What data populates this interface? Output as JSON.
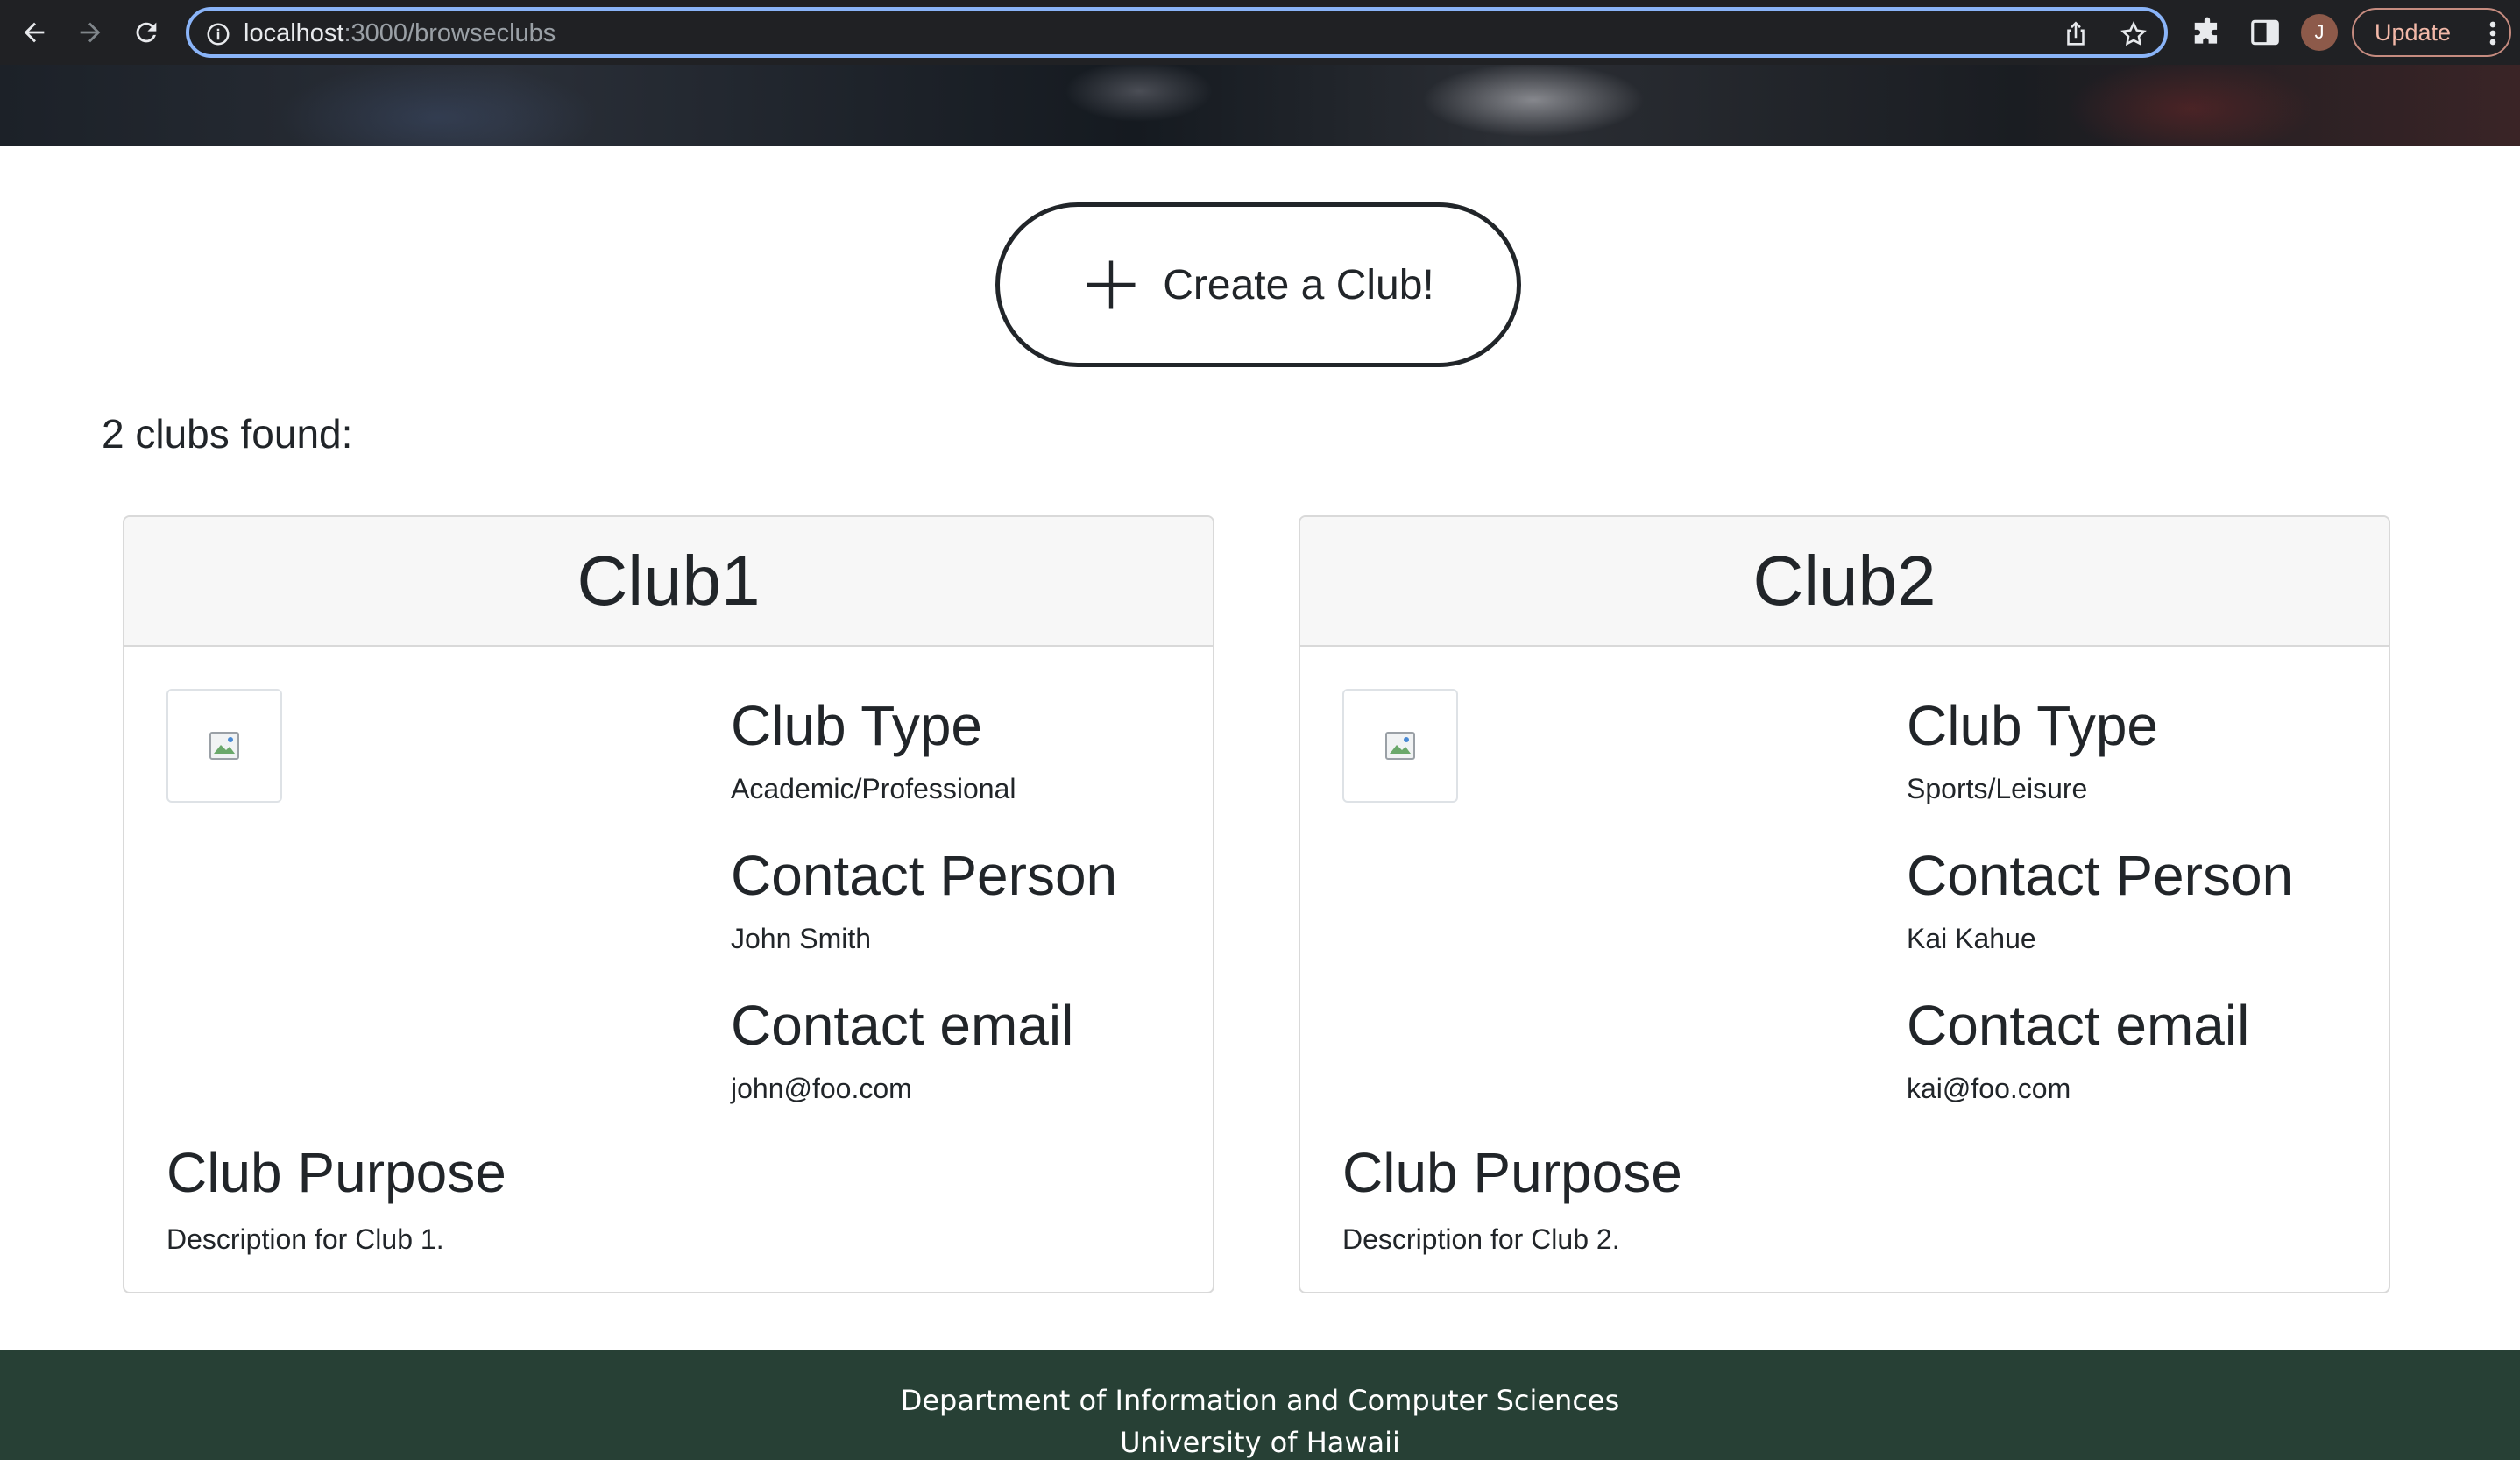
{
  "browser": {
    "url_host": "localhost",
    "url_path": ":3000/browseclubs",
    "profile_initial": "J",
    "update_label": "Update"
  },
  "page": {
    "create_button_label": "Create a Club!",
    "results_count_text": "2 clubs found:"
  },
  "clubs": [
    {
      "name": "Club1",
      "type_heading": "Club Type",
      "type": "Academic/Professional",
      "contact_person_heading": "Contact Person",
      "contact_person": "John Smith",
      "contact_email_heading": "Contact email",
      "contact_email": "john@foo.com",
      "purpose_heading": "Club Purpose",
      "purpose": "Description for Club 1."
    },
    {
      "name": "Club2",
      "type_heading": "Club Type",
      "type": "Sports/Leisure",
      "contact_person_heading": "Contact Person",
      "contact_person": "Kai Kahue",
      "contact_email_heading": "Contact email",
      "contact_email": "kai@foo.com",
      "purpose_heading": "Club Purpose",
      "purpose": "Description for Club 2."
    }
  ],
  "footer": {
    "line1": "Department of Information and Computer Sciences",
    "line2": "University of Hawaii"
  },
  "colors": {
    "footer_bg": "#274035",
    "omnibox_focus": "#8ab4f8",
    "chrome_bg": "#202124"
  }
}
